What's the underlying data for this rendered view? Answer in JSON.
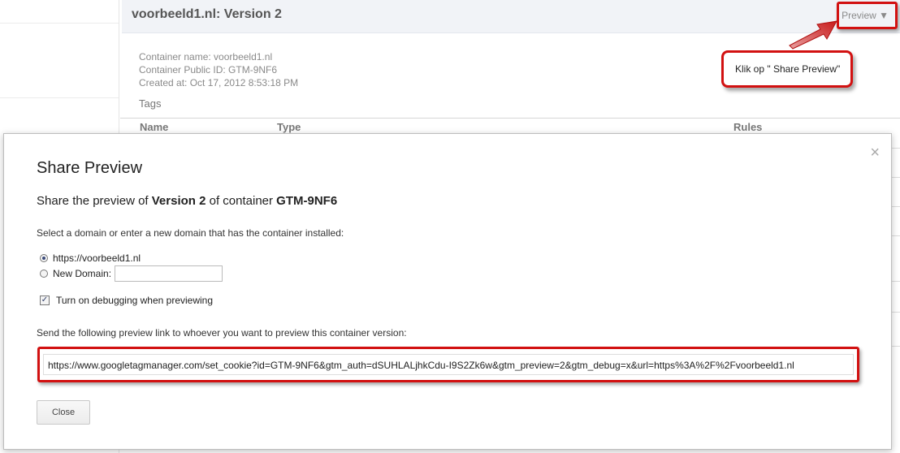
{
  "page": {
    "title": "voorbeeld1.nl: Version 2",
    "preview_label": "Preview ▼"
  },
  "meta": {
    "container_name": "Container name: voorbeeld1.nl",
    "public_id": "Container Public ID: GTM-9NF6",
    "created_at": "Created at: Oct 17, 2012 8:53:18 PM"
  },
  "tags": {
    "label": "Tags",
    "columns": [
      "Name",
      "Type",
      "Rules"
    ]
  },
  "callout": {
    "text": "Klik op \" Share Preview\""
  },
  "dialog": {
    "close_icon": "×",
    "title": "Share Preview",
    "subtitle_prefix": "Share the preview of ",
    "subtitle_version": "Version 2",
    "subtitle_middle": " of container ",
    "subtitle_container": "GTM-9NF6",
    "domain_prompt": "Select a domain or enter a new domain that has the container installed:",
    "domain_option_1": "https://voorbeeld1.nl",
    "domain_option_2": "New Domain:",
    "new_domain_value": "",
    "debug_label": "Turn on debugging when previewing",
    "debug_checked": true,
    "send_label": "Send the following preview link to whoever you want to preview this container version:",
    "preview_link": "https://www.googletagmanager.com/set_cookie?id=GTM-9NF6&gtm_auth=dSUHLALjhkCdu-I9S2Zk6w&gtm_preview=2&gtm_debug=x&url=https%3A%2F%2Fvoorbeeld1.nl",
    "close_button": "Close"
  },
  "colors": {
    "highlight_red": "#d21111",
    "header_bg": "#f1f3f7"
  }
}
